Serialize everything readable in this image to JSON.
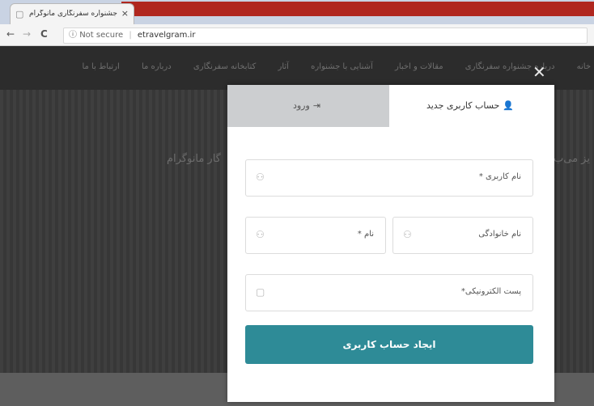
{
  "browser": {
    "tab_title": "جشنواره سفرنگاری مانوگرام",
    "tab_close": "×",
    "tab_icon": "page-icon",
    "url_security": "Not secure",
    "url": "etravelgram.ir",
    "back": "←",
    "forward": "→",
    "reload": "C"
  },
  "site": {
    "nav_items": [
      "خانه",
      "درباره جشنواره سفرنگاری",
      "مقالات و اخبار",
      "آشنایی با جشنواره",
      "آثار",
      "کتابخانه سفرنگاری",
      "درباره ما",
      "ارتباط با ما"
    ],
    "hero_text_left": "گار مانوگرام",
    "hero_text_right": "یز می‌ب"
  },
  "modal": {
    "close": "✕",
    "tabs": {
      "signup": "حساب کاربری جدید",
      "login": "ورود"
    },
    "fields": {
      "username": "نام کاربری *",
      "lastname": "نام خانوادگی",
      "firstname": "نام *",
      "email": "پست الکترونیکی*"
    },
    "submit": "ایجاد حساب کاربری"
  },
  "colors": {
    "accent": "#2e8b97",
    "overlay": "#3b3b3b",
    "inactive_tab": "#ccced0"
  }
}
